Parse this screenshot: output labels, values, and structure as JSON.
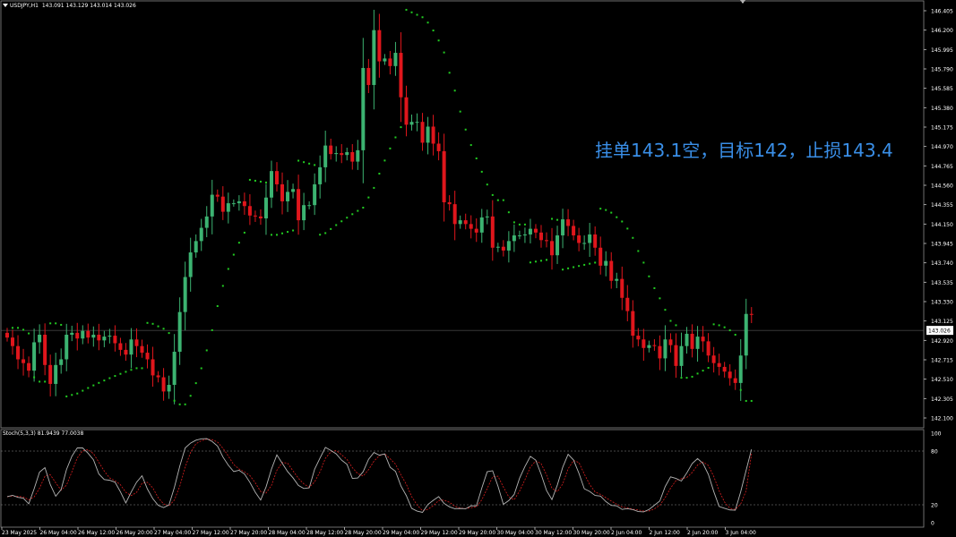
{
  "header": {
    "symbol": "USDJPY,H1",
    "ohlc": "143.091 143.129 143.014 143.026"
  },
  "annotation": "挂单143.1空，目标142，止损143.4",
  "stoch_header": "Stoch(5,3,3) 81.9439 77.0038",
  "colors": {
    "background": "#000000",
    "bull": "#3cb371",
    "bear": "#e0161c",
    "psar": "#22cc22",
    "stoch_main": "#b4b4b4",
    "stoch_signal": "#d81e1e",
    "text": "#ffffff",
    "annotation": "#3a8fe8"
  },
  "chart_data": [
    {
      "type": "candlestick",
      "title": "USDJPY,H1",
      "ylim": [
        142.1,
        146.405
      ],
      "y_ticks": [
        "146.405",
        "146.200",
        "145.995",
        "145.790",
        "145.585",
        "145.380",
        "145.175",
        "144.970",
        "144.765",
        "144.560",
        "144.355",
        "144.150",
        "143.945",
        "143.740",
        "143.535",
        "143.330",
        "143.125",
        "142.920",
        "142.715",
        "142.510",
        "142.305",
        "142.100"
      ],
      "x_ticks": [
        "23 May 2025",
        "26 May 04:00",
        "26 May 12:00",
        "26 May 20:00",
        "27 May 04:00",
        "27 May 12:00",
        "27 May 20:00",
        "28 May 04:00",
        "28 May 12:00",
        "28 May 20:00",
        "29 May 04:00",
        "29 May 12:00",
        "29 May 20:00",
        "30 May 04:00",
        "30 May 12:00",
        "30 May 20:00",
        "2 Jun 04:00",
        "2 Jun 12:00",
        "2 Jun 20:00",
        "3 Jun 04:00"
      ],
      "current_price": "143.026",
      "close": [
        142.95,
        142.86,
        142.72,
        142.68,
        142.6,
        142.9,
        142.98,
        142.66,
        142.46,
        142.66,
        142.72,
        142.98,
        143.0,
        142.94,
        143.02,
        142.95,
        142.98,
        142.92,
        142.96,
        142.97,
        142.89,
        142.82,
        142.77,
        142.93,
        142.86,
        142.79,
        142.72,
        142.55,
        142.53,
        142.38,
        142.45,
        142.8,
        143.22,
        143.59,
        143.85,
        143.97,
        144.11,
        144.23,
        144.46,
        144.44,
        144.28,
        144.37,
        144.37,
        144.39,
        144.34,
        144.24,
        144.23,
        144.21,
        144.43,
        144.71,
        144.57,
        144.39,
        144.49,
        144.52,
        144.19,
        144.35,
        144.35,
        144.57,
        144.75,
        144.98,
        144.89,
        144.9,
        144.88,
        144.91,
        144.81,
        144.93,
        145.8,
        145.62,
        146.2,
        145.87,
        145.9,
        145.82,
        145.96,
        145.49,
        145.2,
        145.23,
        145.23,
        145.01,
        145.18,
        145.0,
        144.92,
        144.38,
        144.36,
        144.15,
        144.19,
        144.15,
        144.1,
        144.06,
        144.22,
        144.23,
        143.9,
        143.91,
        143.87,
        143.97,
        144.03,
        144.03,
        144.04,
        144.1,
        144.06,
        143.98,
        143.97,
        143.82,
        144.03,
        144.2,
        144.13,
        144.03,
        143.95,
        143.95,
        144.04,
        143.9,
        143.71,
        143.76,
        143.55,
        143.57,
        143.37,
        143.23,
        142.97,
        142.93,
        142.84,
        142.87,
        142.86,
        142.73,
        142.93,
        142.87,
        142.65,
        142.86,
        142.99,
        142.83,
        142.96,
        142.91,
        142.76,
        142.68,
        142.64,
        142.59,
        142.52,
        142.47,
        142.76,
        143.2,
        143.19
      ]
    },
    {
      "type": "line",
      "title": "Stoch(5,3,3) 81.9439 77.0038",
      "ylim": [
        0,
        100
      ],
      "y_ticks": [
        "100",
        "80",
        "20",
        "0"
      ],
      "levels": [
        80,
        20
      ],
      "last_main": 81.9439,
      "last_signal": 77.0038
    }
  ]
}
